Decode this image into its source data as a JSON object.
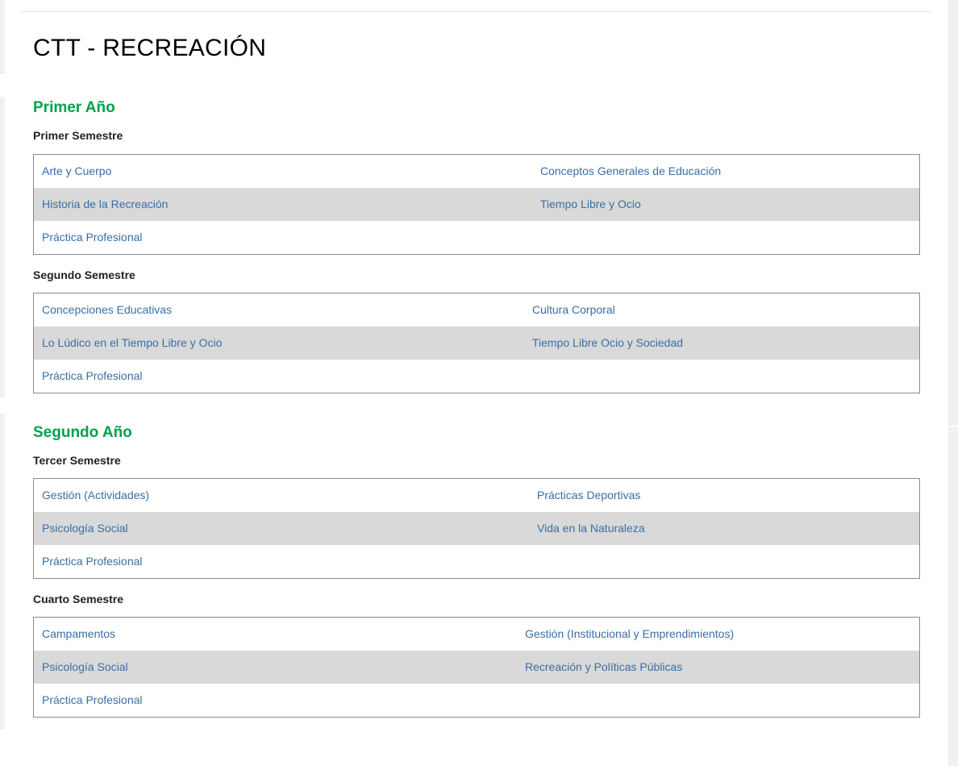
{
  "page": {
    "title": "CTT - RECREACIÓN"
  },
  "years": [
    {
      "title": "Primer Año",
      "semesters": [
        {
          "title": "Primer Semestre",
          "rows": [
            [
              "Arte y Cuerpo",
              "Conceptos Generales de Educación"
            ],
            [
              "Historia de la Recreación",
              "Tiempo Libre y Ocio"
            ],
            [
              "Práctica Profesional",
              ""
            ]
          ]
        },
        {
          "title": "Segundo Semestre",
          "rows": [
            [
              "Concepciones Educativas",
              "Cultura Corporal"
            ],
            [
              "Lo Lúdico en el Tiempo Libre y Ocio",
              "Tiempo Libre Ocio y Sociedad"
            ],
            [
              "Práctica Profesional",
              ""
            ]
          ]
        }
      ]
    },
    {
      "title": "Segundo Año",
      "semesters": [
        {
          "title": "Tercer Semestre",
          "rows": [
            [
              "Gestión (Actividades)",
              "Prácticas Deportivas"
            ],
            [
              "Psicología Social",
              "Vida en la Naturaleza"
            ],
            [
              "Práctica Profesional",
              ""
            ]
          ]
        },
        {
          "title": "Cuarto Semestre",
          "rows": [
            [
              "Campamentos",
              "Gestión (Institucional y Emprendimientos)"
            ],
            [
              "Psicología Social",
              "Recreación y Políticas Públicas"
            ],
            [
              "Práctica Profesional",
              ""
            ]
          ]
        }
      ]
    }
  ],
  "colors": {
    "year_heading": "#00a14b",
    "link": "#3a6ea5",
    "alt_row": "#d9d9d9",
    "table_border": "#8a8a8a"
  }
}
